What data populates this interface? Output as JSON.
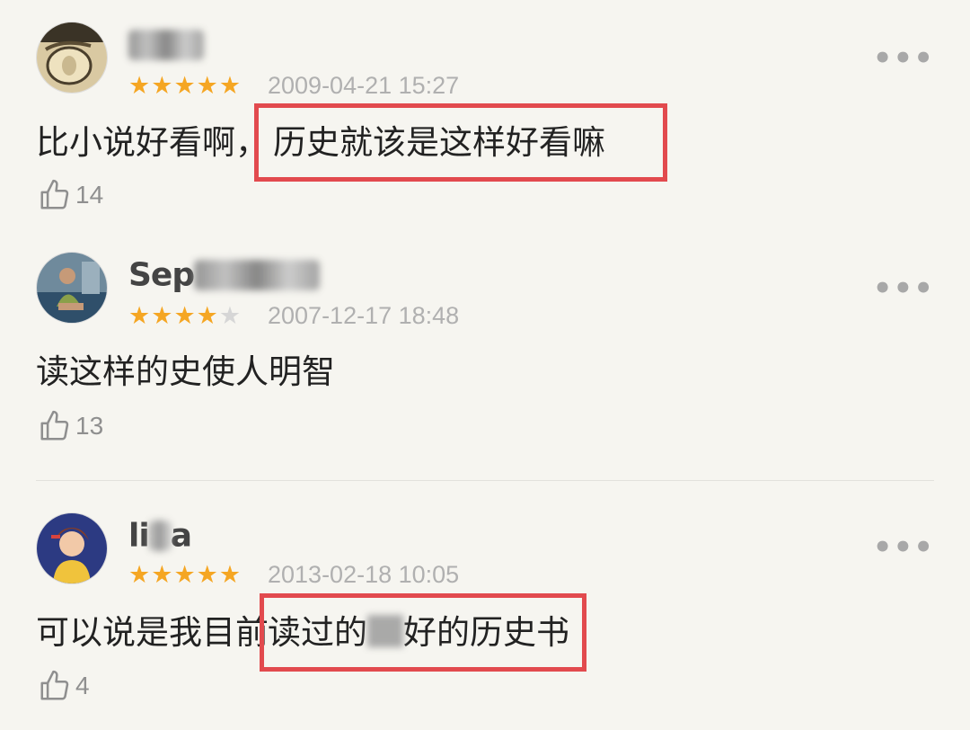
{
  "comments": [
    {
      "username_visible": "",
      "rating": 5,
      "date": "2009-04-21 15:27",
      "text_before": "比小说好看啊，",
      "text_highlight": "历史就该是这样好看嘛",
      "likes": "14"
    },
    {
      "username_visible": "Sep",
      "rating": 4,
      "date": "2007-12-17 18:48",
      "text": "读这样的史使人明智",
      "likes": "13"
    },
    {
      "username_visible_start": "li",
      "username_visible_end": "a",
      "rating": 5,
      "date": "2013-02-18 10:05",
      "text_before": "可以说是我目前",
      "text_highlight_a": "读过的",
      "text_highlight_b": "好的历史书",
      "likes": "4"
    }
  ],
  "icons": {
    "star": "★",
    "more": "•••",
    "like": "thumbs-up-icon"
  },
  "colors": {
    "background": "#f6f5f0",
    "star": "#f5a623",
    "star_empty": "#d6d6d6",
    "highlight_box": "#e24a4e",
    "date": "#b0b0b0"
  }
}
